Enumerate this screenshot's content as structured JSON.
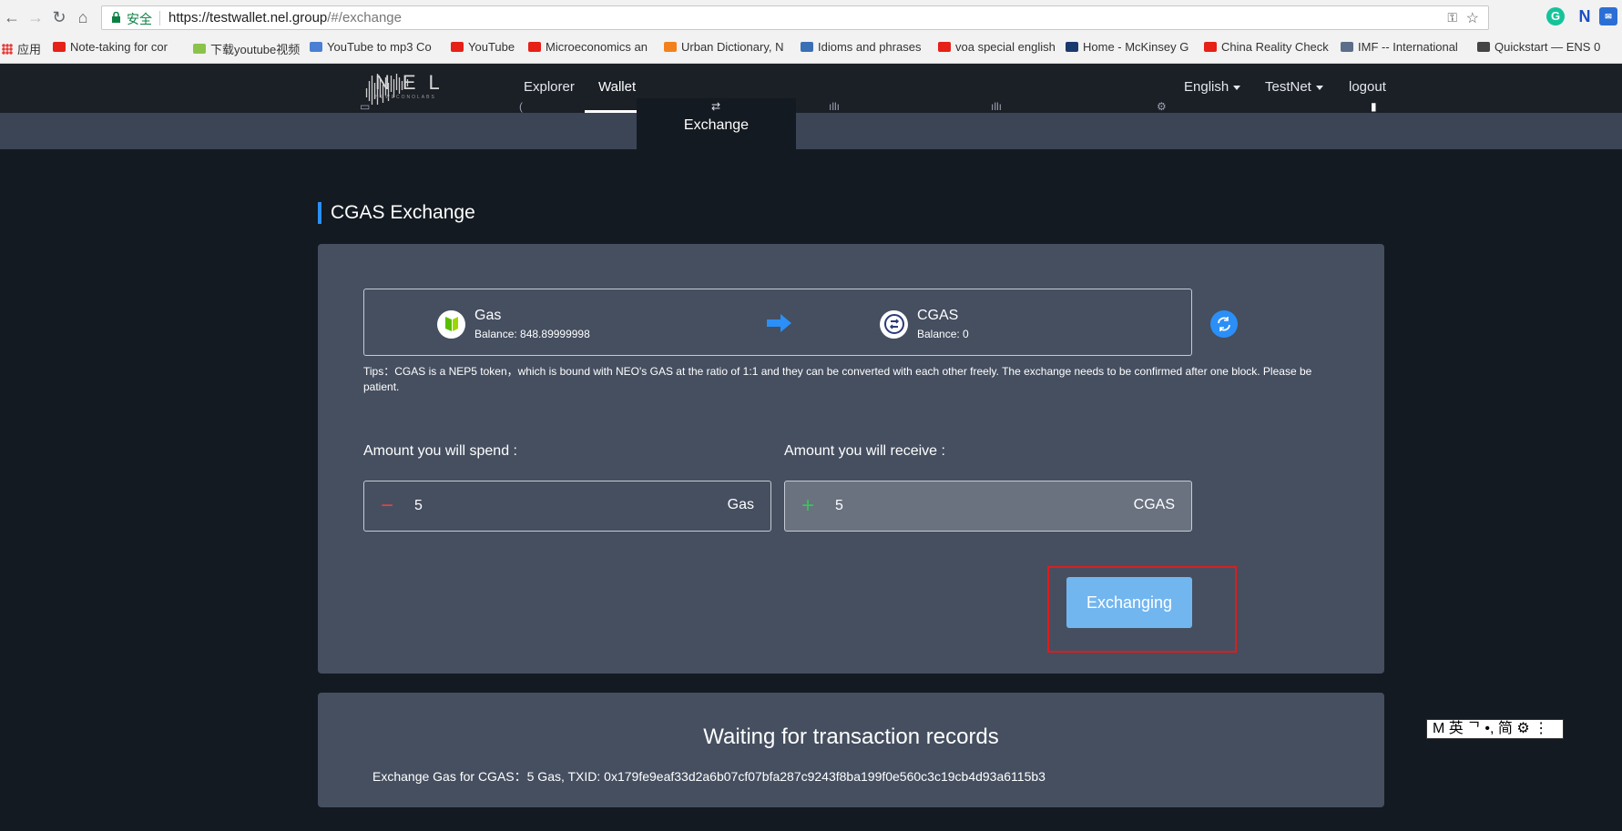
{
  "browser": {
    "secure_label": "安全",
    "url_host": "https://testwallet.nel.group",
    "url_rest": "/#/exchange",
    "apps_label": "应用",
    "bookmarks": [
      {
        "label": "Note-taking for cor",
        "color": "#e62117"
      },
      {
        "label": "下载youtube视频",
        "color": "#8bc34a"
      },
      {
        "label": "YouTube to mp3 Co",
        "color": "#4a7fd4"
      },
      {
        "label": "YouTube",
        "color": "#e62117"
      },
      {
        "label": "Microeconomics an",
        "color": "#e62117"
      },
      {
        "label": "Urban Dictionary, N",
        "color": "#f2811d"
      },
      {
        "label": "Idioms and phrases",
        "color": "#3a6fb5"
      },
      {
        "label": "voa special english",
        "color": "#e62117"
      },
      {
        "label": "Home - McKinsey G",
        "color": "#1a3a6e"
      },
      {
        "label": "China Reality Check",
        "color": "#e62117"
      },
      {
        "label": "IMF -- International",
        "color": "#5b6e8a"
      },
      {
        "label": "Quickstart — ENS 0",
        "color": "#444444"
      }
    ]
  },
  "header": {
    "logo_text": "NEL",
    "logo_sub": "NEWECONOLABS",
    "nav": {
      "explorer": "Explorer",
      "wallet": "Wallet"
    },
    "language": "English",
    "network": "TestNet",
    "logout": "logout"
  },
  "subnav": {
    "active": "Exchange"
  },
  "exchange": {
    "title": "CGAS Exchange",
    "from_token": {
      "name": "Gas",
      "balance": "Balance: 848.89999998"
    },
    "to_token": {
      "name": "CGAS",
      "balance": "Balance: 0"
    },
    "tips": "Tips：CGAS is a NEP5 token，which is bound with NEO's GAS at the ratio of 1:1 and they can be converted with each other freely. The exchange needs to be confirmed after one block. Please be patient.",
    "spend_label": "Amount you will spend :",
    "receive_label": "Amount you will receive :",
    "spend_value": "5",
    "spend_unit": "Gas",
    "receive_value": "5",
    "receive_unit": "CGAS",
    "button_label": "Exchanging"
  },
  "records": {
    "title": "Waiting for transaction records",
    "entry": "Exchange Gas for CGAS：5 Gas, TXID: 0x179fe9eaf33d2a6b07cf07bfa287c9243f8ba199f0e560c3c19cb4d93a6115b3"
  },
  "ime": {
    "text": "M 英 ᄀ •, 简 ⚙ ⋮"
  },
  "colors": {
    "accent": "#2b8ff7",
    "highlight": "#e01b1b",
    "button": "#72b6f0",
    "card": "#454f60"
  }
}
